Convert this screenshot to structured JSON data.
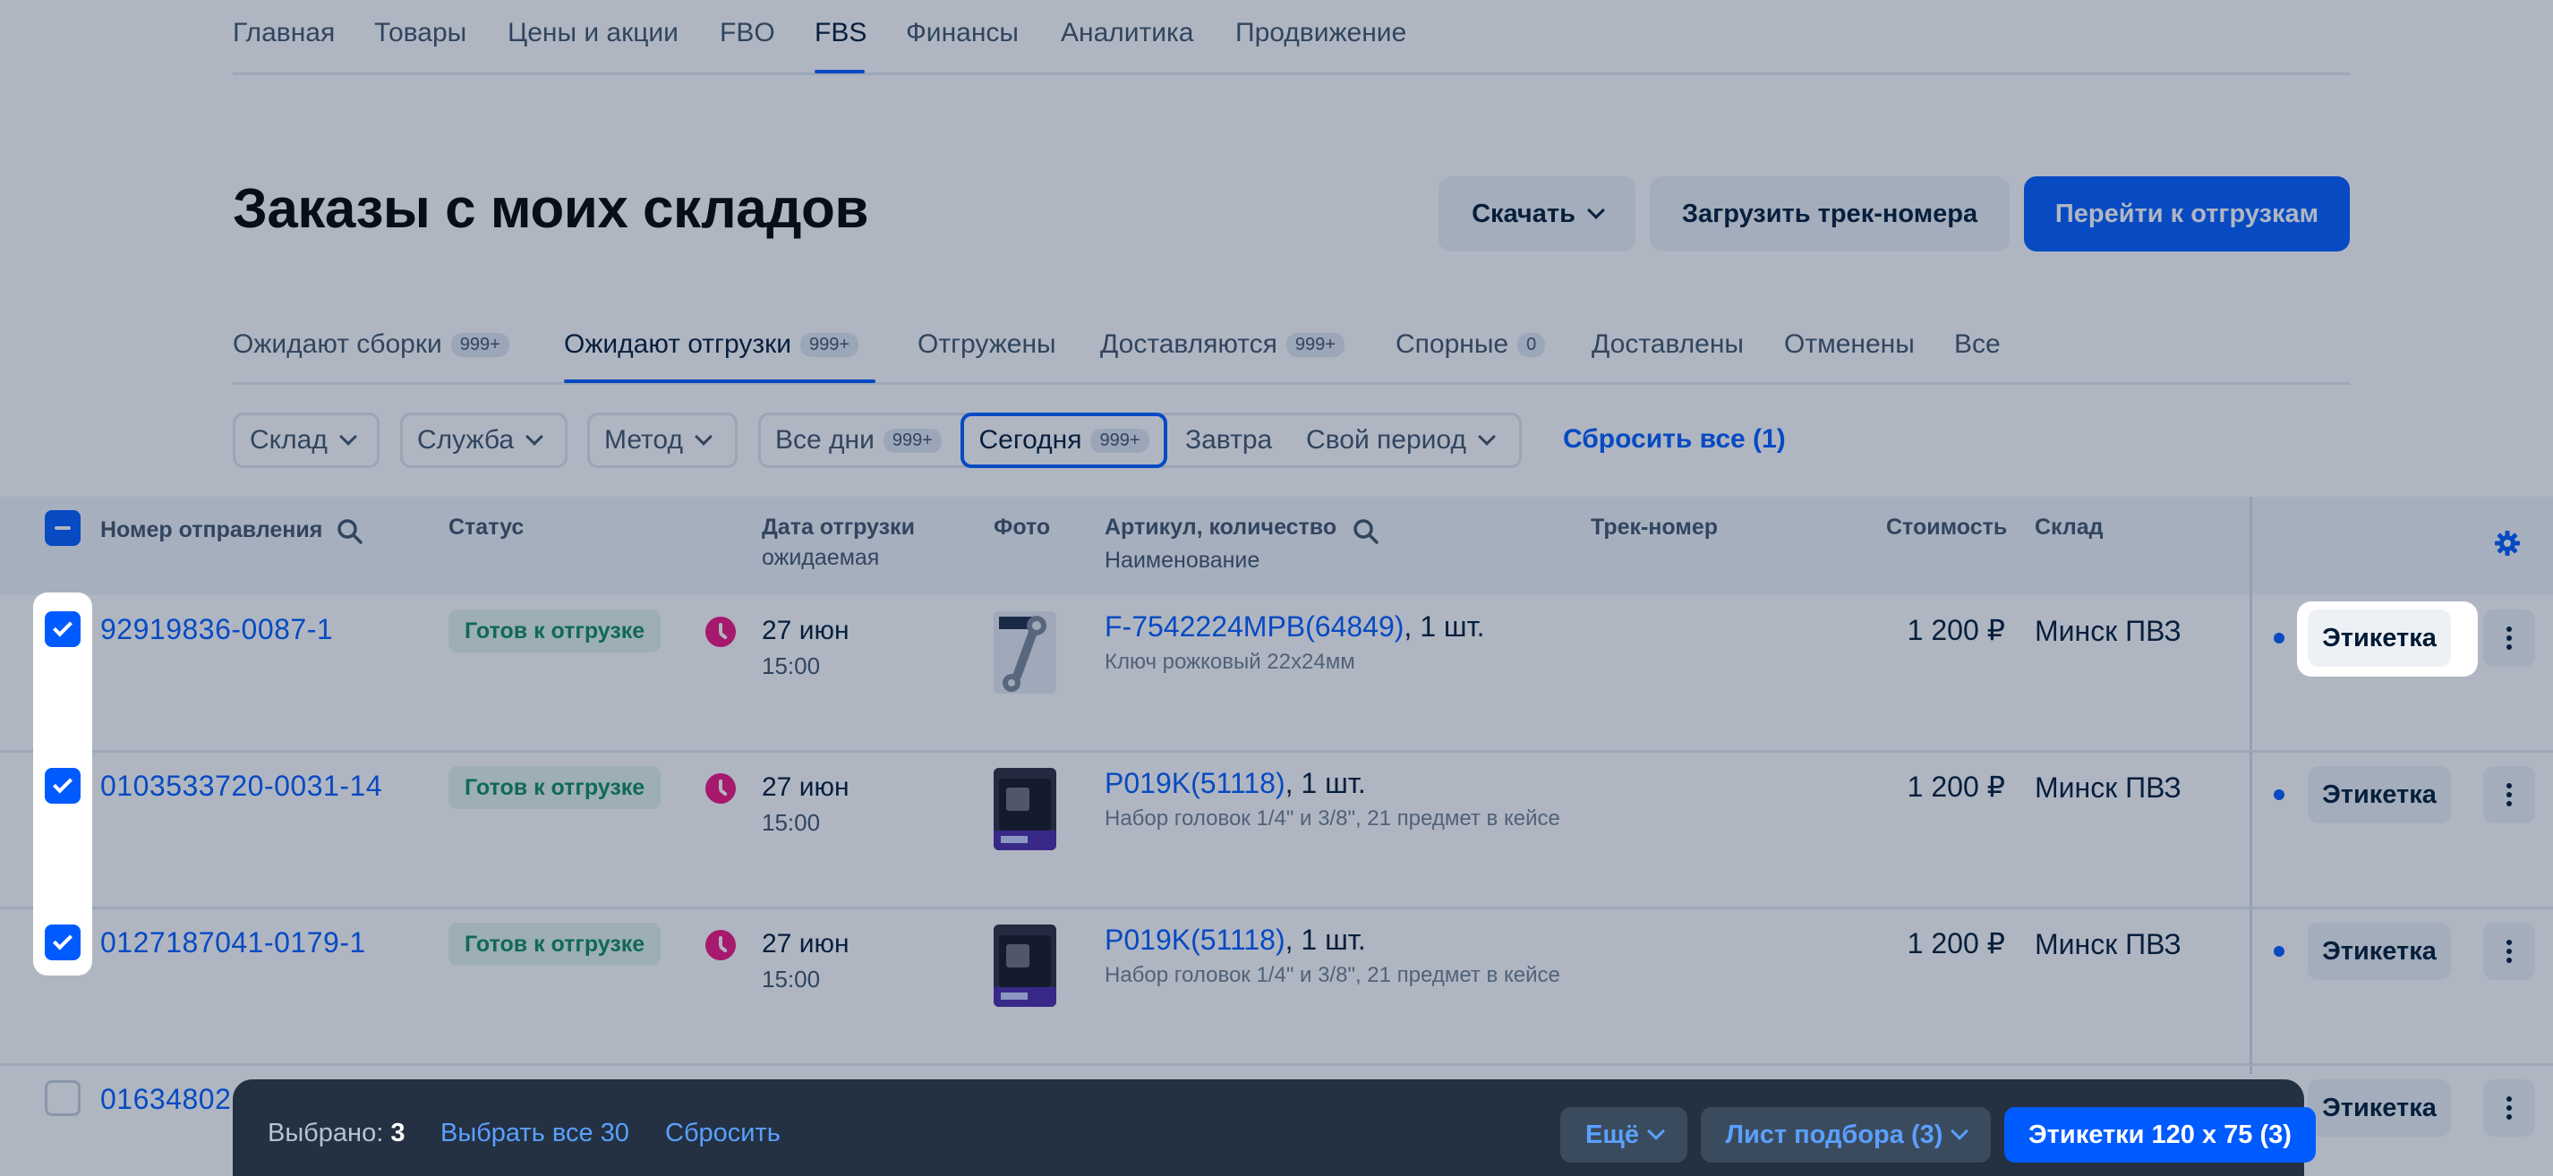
{
  "nav": {
    "items": [
      "Главная",
      "Товары",
      "Цены и акции",
      "FBO",
      "FBS",
      "Финансы",
      "Аналитика",
      "Продвижение"
    ],
    "active": "FBS"
  },
  "page_title": "Заказы с моих складов",
  "header_buttons": {
    "download": "Скачать",
    "upload_tracks": "Загрузить трек-номера",
    "go_to_shipments": "Перейти к отгрузкам"
  },
  "tabs": [
    {
      "label": "Ожидают сборки",
      "badge": "999+"
    },
    {
      "label": "Ожидают отгрузки",
      "badge": "999+"
    },
    {
      "label": "Отгружены",
      "badge": ""
    },
    {
      "label": "Доставляются",
      "badge": "999+"
    },
    {
      "label": "Спорные",
      "badge": "0"
    },
    {
      "label": "Доставлены",
      "badge": ""
    },
    {
      "label": "Отменены",
      "badge": ""
    },
    {
      "label": "Все",
      "badge": ""
    }
  ],
  "filters": {
    "warehouse": "Склад",
    "service": "Служба",
    "method": "Метод",
    "all_days": "Все дни",
    "all_days_badge": "999+",
    "today": "Сегодня",
    "today_badge": "999+",
    "tomorrow": "Завтра",
    "own_period": "Свой период",
    "reset_all": "Сбросить все (1)"
  },
  "table": {
    "headers": {
      "number": "Номер отправления",
      "status": "Статус",
      "ship_date": "Дата отгрузки",
      "ship_date_sub": "ожидаемая",
      "photo": "Фото",
      "sku_qty": "Артикул, количество",
      "sku_name": "Наименование",
      "track": "Трек-номер",
      "cost": "Стоимость",
      "warehouse": "Склад"
    },
    "rows": [
      {
        "number": "92919836-0087-1",
        "status": "Готов к отгрузке",
        "date": "27 июн",
        "time": "15:00",
        "sku": "F-7542224MPB(64849)",
        "qty": ", 1 шт.",
        "name": "Ключ рожковый 22х24мм",
        "price": "1 200 ₽",
        "warehouse": "Минск ПВЗ",
        "label_btn": "Этикетка"
      },
      {
        "number": "0103533720-0031-14",
        "status": "Готов к отгрузке",
        "date": "27 июн",
        "time": "15:00",
        "sku": "P019K(51118)",
        "qty": ", 1 шт.",
        "name": "Набор головок 1/4\" и 3/8\", 21 предмет в кейсе",
        "price": "1 200 ₽",
        "warehouse": "Минск ПВЗ",
        "label_btn": "Этикетка"
      },
      {
        "number": "0127187041-0179-1",
        "status": "Готов к отгрузке",
        "date": "27 июн",
        "time": "15:00",
        "sku": "P019K(51118)",
        "qty": ", 1 шт.",
        "name": "Набор головок 1/4\" и 3/8\", 21 предмет в кейсе",
        "price": "1 200 ₽",
        "warehouse": "Минск ПВЗ",
        "label_btn": "Этикетка"
      },
      {
        "number": "01634802",
        "label_btn": "Этикетка"
      }
    ]
  },
  "bottom_bar": {
    "selected_label": "Выбрано:",
    "selected_count": "3",
    "select_all": "Выбрать все 30",
    "reset": "Сбросить",
    "more": "Ещё",
    "pick_list": "Лист подбора (3)",
    "labels": "Этикетки 120 х 75 (3)"
  },
  "colors": {
    "accent": "#005bff",
    "status_ok_bg": "#e4f3ec",
    "status_ok_text": "#0f8a5f",
    "clock": "#f1117e",
    "bottom_bar": "#233142"
  }
}
